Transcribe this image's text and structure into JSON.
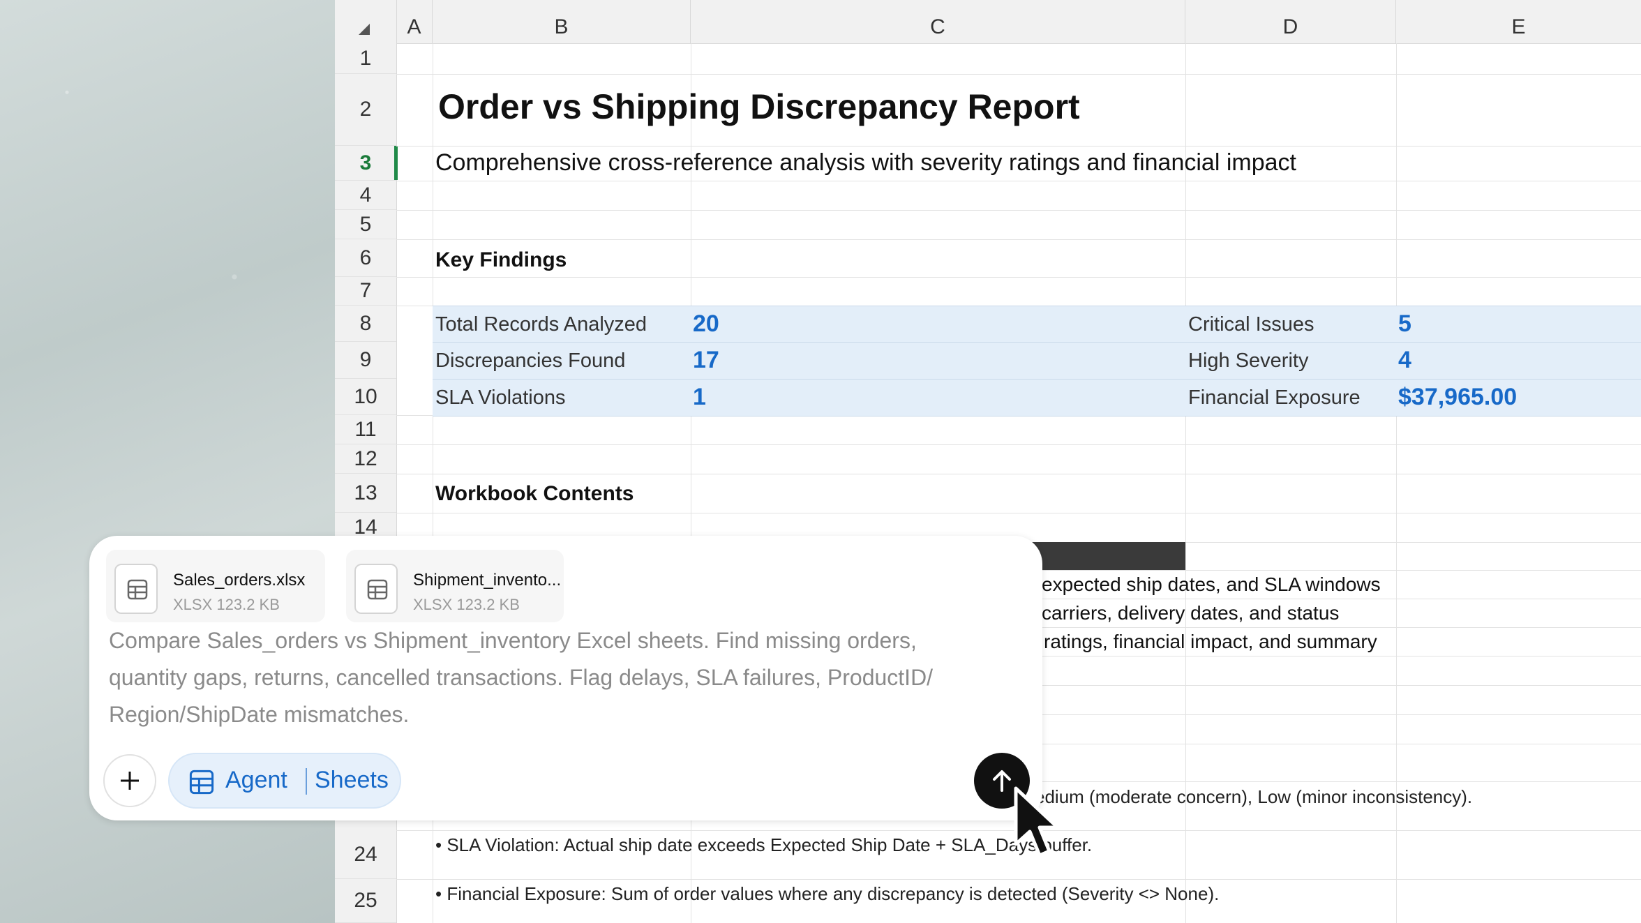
{
  "sheet": {
    "columns": [
      "A",
      "B",
      "C",
      "D",
      "E"
    ],
    "rows": [
      "1",
      "2",
      "3",
      "4",
      "5",
      "6",
      "7",
      "8",
      "9",
      "10",
      "11",
      "12",
      "13",
      "14",
      "24",
      "25"
    ],
    "active_row": "3",
    "title": "Order vs Shipping Discrepancy Report",
    "subtitle": "Comprehensive cross-reference analysis with severity ratings and financial impact",
    "key_findings_heading": "Key Findings",
    "metrics": [
      {
        "label": "Total Records Analyzed",
        "value": "20"
      },
      {
        "label": "Discrepancies Found",
        "value": "17"
      },
      {
        "label": "SLA Violations",
        "value": "1"
      },
      {
        "label": "Critical Issues",
        "value": "5"
      },
      {
        "label": "High Severity",
        "value": "4"
      },
      {
        "label": "Financial Exposure",
        "value": "$37,965.00"
      }
    ],
    "workbook_contents_heading": "Workbook Contents",
    "contents_lines": [
      "expected ship dates, and SLA windows",
      "carriers, delivery dates, and status",
      "ratings, financial impact, and summary"
    ],
    "notes": [
      "edium (moderate concern), Low (minor inconsistency).",
      "• SLA Violation: Actual ship date exceeds Expected Ship Date + SLA_Days buffer.",
      "• Financial Exposure: Sum of order values where any discrepancy is detected (Severity <> None)."
    ]
  },
  "composer": {
    "attachments": [
      {
        "name": "Sales_orders.xlsx",
        "meta": "XLSX 123.2 KB"
      },
      {
        "name": "Shipment_invento...",
        "meta": "XLSX 123.2 KB"
      }
    ],
    "prompt": "Compare Sales_orders vs Shipment_inventory Excel sheets. Find missing orders, quantity gaps, returns, cancelled transactions. Flag delays, SLA failures, ProductID/ Region/ShipDate mismatches.",
    "agent_label": "Agent",
    "agent_mode": "Sheets"
  },
  "colors": {
    "accent": "#1769c8",
    "active_row": "#1f8a48",
    "band": "#e3eef9"
  }
}
